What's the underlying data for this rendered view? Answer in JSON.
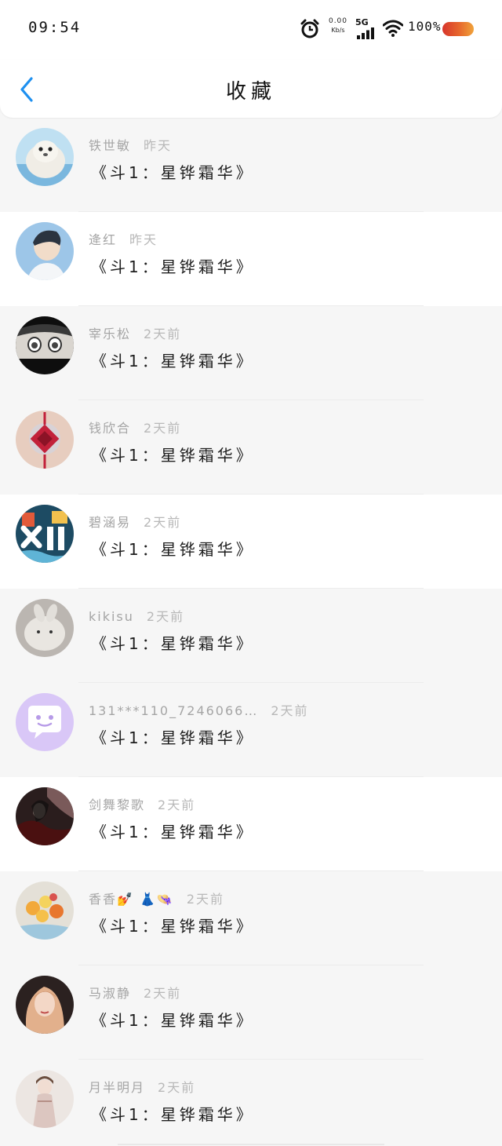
{
  "status_bar": {
    "time": "09:54",
    "net_speed_value": "0.00",
    "net_speed_unit": "Kb/s",
    "network_type": "5G",
    "battery_percent": "100%",
    "icons": [
      "alarm-icon",
      "signal-icon",
      "wifi-icon",
      "battery-icon"
    ],
    "battery_color": "#e7692d"
  },
  "header": {
    "title": "收藏",
    "back_icon": "chevron-left-icon",
    "accent_color": "#1e90f0"
  },
  "favorites": [
    {
      "user": "铁世敏",
      "time": "昨天",
      "title": "《斗1：星铧霜华》",
      "avatar": "seal-avatar"
    },
    {
      "user": "逄红",
      "time": "昨天",
      "title": "《斗1：星铧霜华》",
      "avatar": "boy-portrait-avatar"
    },
    {
      "user": "宰乐松",
      "time": "2天前",
      "title": "《斗1：星铧霜华》",
      "avatar": "anime-face-avatar"
    },
    {
      "user": "钱欣合",
      "time": "2天前",
      "title": "《斗1：星铧霜华》",
      "avatar": "chinese-knot-avatar"
    },
    {
      "user": "碧涵易",
      "time": "2天前",
      "title": "《斗1：星铧霜华》",
      "avatar": "festival-poster-avatar"
    },
    {
      "user": "kikisu",
      "time": "2天前",
      "title": "《斗1：星铧霜华》",
      "avatar": "plush-toy-avatar"
    },
    {
      "user": "131***110_7246066…",
      "time": "2天前",
      "title": "《斗1：星铧霜华》",
      "avatar": "default-chat-avatar"
    },
    {
      "user": "剑舞黎歌",
      "time": "2天前",
      "title": "《斗1：星铧霜华》",
      "avatar": "dark-artwork-avatar"
    },
    {
      "user": "香香💅 👗👒",
      "time": "2天前",
      "title": "《斗1：星铧霜华》",
      "avatar": "flowers-avatar"
    },
    {
      "user": "马淑静",
      "time": "2天前",
      "title": "《斗1：星铧霜华》",
      "avatar": "girl-illustration-avatar"
    },
    {
      "user": "月半明月",
      "time": "2天前",
      "title": "《斗1：星铧霜华》",
      "avatar": "costume-figure-avatar"
    }
  ]
}
